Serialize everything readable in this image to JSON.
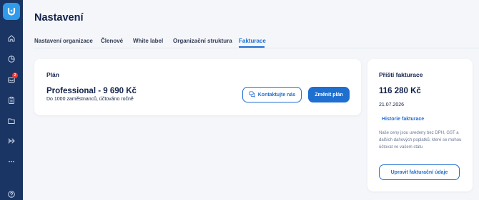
{
  "sidebar": {
    "logo_icon": "app-logo-icon",
    "notification_count": "2",
    "items": [
      {
        "icon": "home-icon"
      },
      {
        "icon": "analytics-icon"
      },
      {
        "icon": "inbox-icon"
      },
      {
        "icon": "clipboard-icon"
      },
      {
        "icon": "folder-icon"
      },
      {
        "icon": "send-icon"
      },
      {
        "icon": "more-icon"
      },
      {
        "icon": "help-icon"
      }
    ]
  },
  "header": {
    "title": "Nastavení"
  },
  "tabs": [
    {
      "label": "Nastavení organizace"
    },
    {
      "label": "Členové"
    },
    {
      "label": "White label"
    },
    {
      "label": "Organizační struktura"
    },
    {
      "label": "Fakturace",
      "active": true
    }
  ],
  "plan": {
    "section_label": "Plán",
    "name": "Professional - 9 690 Kč",
    "description": "Do 1000 zaměstnanců, účtováno ročně",
    "contact_button": "Kontaktujte nás",
    "change_button": "Změnit plán"
  },
  "billing": {
    "title": "Příští fakturace",
    "amount": "116 280 Kč",
    "date": "21.07.2026",
    "history_link": "Historie fakturace",
    "note": "Naše ceny jsou uvedeny bez DPH, GST a dalších daňových poplatků, které se mohou účtovat ve vašem státu",
    "edit_button": "Upravit fakturační údaje"
  },
  "colors": {
    "sidebar": "#1a3563",
    "accent": "#1f6fd1",
    "logo": "#2f9bea",
    "badge": "#e53935"
  }
}
